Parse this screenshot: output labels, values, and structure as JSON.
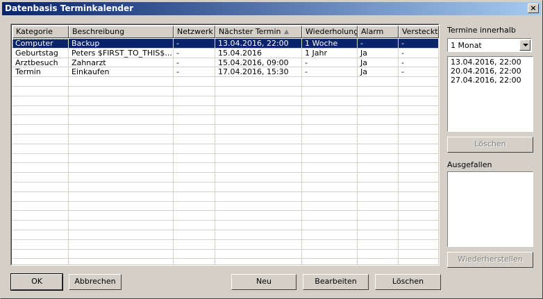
{
  "window": {
    "title": "Datenbasis Terminkalender",
    "close": "×"
  },
  "table": {
    "columns": [
      "Kategorie",
      "Beschreibung",
      "Netzwerk",
      "Nächster Termin",
      "Wiederholung",
      "Alarm",
      "Versteckt"
    ],
    "sort_indicator": "▲",
    "rows": [
      [
        "Computer",
        "Backup",
        "-",
        "13.04.2016, 22:00",
        "1 Woche",
        "-",
        "-"
      ],
      [
        "Geburtstag",
        "Peters $FIRST_TO_THIS$...",
        "-",
        "15.04.2016",
        "1 Jahr",
        "Ja",
        "-"
      ],
      [
        "Arztbesuch",
        "Zahnarzt",
        "-",
        "15.04.2016, 09:00",
        "-",
        "Ja",
        "-"
      ],
      [
        "Termin",
        "Einkaufen",
        "-",
        "17.04.2016, 15:30",
        "-",
        "Ja",
        "-"
      ]
    ],
    "selected_row": 0,
    "empty_rows": 21
  },
  "sidebar": {
    "range_label": "Termine innerhalb",
    "range_value": "1 Monat",
    "dates": [
      "13.04.2016, 22:00",
      "20.04.2016, 22:00",
      "27.04.2016, 22:00"
    ],
    "delete_label": "Löschen",
    "cancelled_label": "Ausgefallen",
    "restore_label": "Wiederherstellen"
  },
  "buttons": {
    "ok": "OK",
    "cancel": "Abbrechen",
    "new": "Neu",
    "edit": "Bearbeiten",
    "delete": "Löschen"
  }
}
